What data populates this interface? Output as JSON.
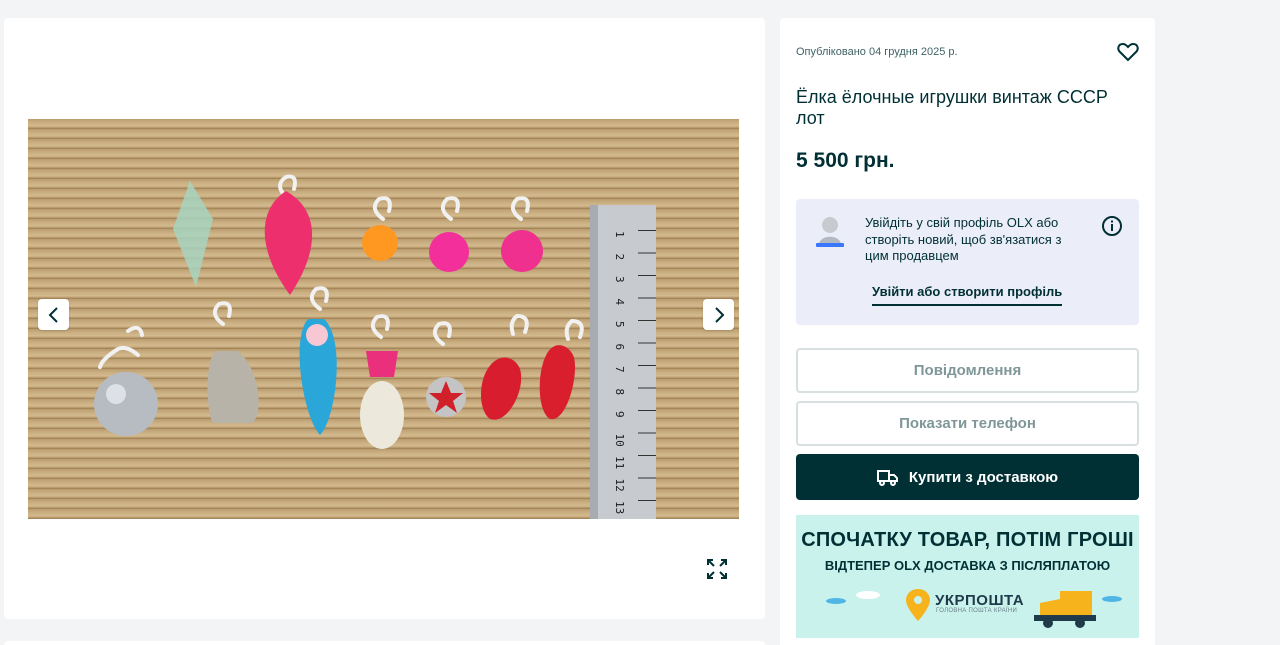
{
  "listing": {
    "posted": "Опубліковано 04 грудня 2025 р.",
    "title": "Ёлка ёлочные игрушки винтаж СССР лот",
    "price": "5 500 грн."
  },
  "login_prompt": {
    "text": "Увійдіть у свій профіль OLX або створіть новий, щоб зв'язатися з цим продавцем",
    "link": "Увійти або створити профіль"
  },
  "actions": {
    "message": "Повідомлення",
    "phone": "Показати телефон",
    "buy": "Купити з доставкою"
  },
  "promo": {
    "headline": "СПОЧАТКУ ТОВАР, ПОТІМ ГРОШІ",
    "subline": "ВІДТЕПЕР OLX ДОСТАВКА З ПІСЛЯПЛАТОЮ",
    "brand": "УКРПОШТА",
    "slogan": "ГОЛОВНА ПОШТА КРАЇНИ"
  },
  "ruler_ticks": [
    "1",
    "2",
    "3",
    "4",
    "5",
    "6",
    "7",
    "8",
    "9",
    "10",
    "11",
    "12",
    "13"
  ],
  "icons": {
    "prev": "chevron-left-icon",
    "next": "chevron-right-icon",
    "expand": "expand-icon",
    "favorite": "heart-icon",
    "info": "info-icon",
    "truck": "truck-icon"
  },
  "colors": {
    "primary": "#002f34",
    "login_bg": "#ebeef9",
    "promo_bg": "#c9f2ec",
    "muted_text": "#7f9799"
  }
}
